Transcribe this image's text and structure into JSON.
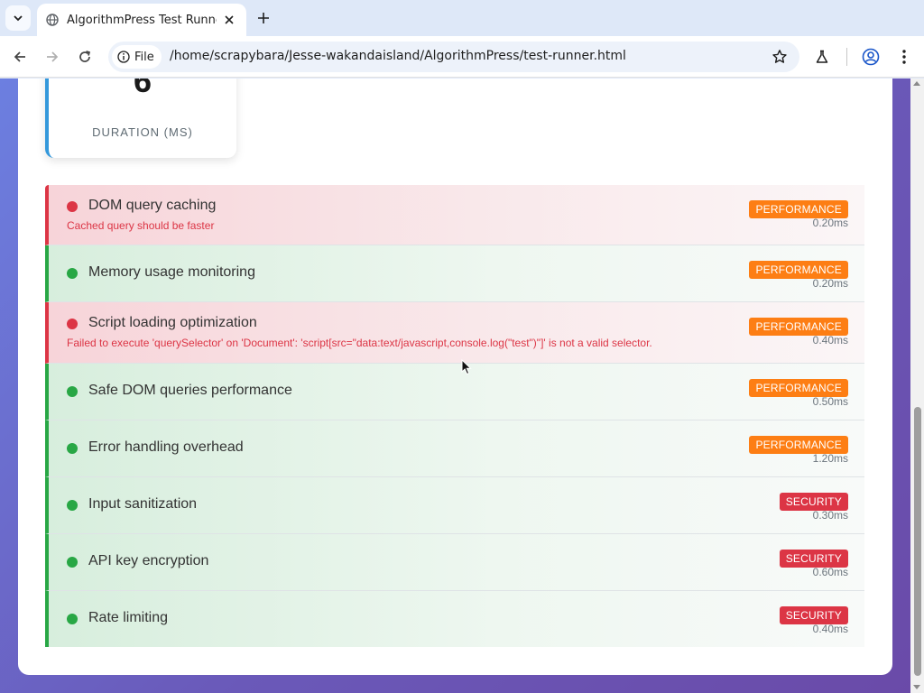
{
  "browser": {
    "tab_title": "AlgorithmPress Test Runner",
    "file_chip_label": "File",
    "url": "/home/scrapybara/Jesse-wakandaisland/AlgorithmPress/test-runner.html"
  },
  "summary": {
    "duration_value": "6",
    "duration_label": "DURATION (MS)"
  },
  "tests": [
    {
      "status": "fail",
      "name": "DOM query caching",
      "error": "Cached query should be faster",
      "category": "PERFORMANCE",
      "time": "0.20ms"
    },
    {
      "status": "pass",
      "name": "Memory usage monitoring",
      "category": "PERFORMANCE",
      "time": "0.20ms"
    },
    {
      "status": "fail",
      "name": "Script loading optimization",
      "error": "Failed to execute 'querySelector' on 'Document': 'script[src=\"data:text/javascript,console.log(\"test\")\"]' is not a valid selector.",
      "category": "PERFORMANCE",
      "time": "0.40ms"
    },
    {
      "status": "pass",
      "name": "Safe DOM queries performance",
      "category": "PERFORMANCE",
      "time": "0.50ms"
    },
    {
      "status": "pass",
      "name": "Error handling overhead",
      "category": "PERFORMANCE",
      "time": "1.20ms"
    },
    {
      "status": "pass",
      "name": "Input sanitization",
      "category": "SECURITY",
      "time": "0.30ms"
    },
    {
      "status": "pass",
      "name": "API key encryption",
      "category": "SECURITY",
      "time": "0.60ms"
    },
    {
      "status": "pass",
      "name": "Rate limiting",
      "category": "SECURITY",
      "time": "0.40ms"
    }
  ],
  "colors": {
    "pass": "#28a745",
    "fail": "#dc3545",
    "performance_badge": "#fd7e14",
    "security_badge": "#dc3545",
    "duration_accent": "#3498db"
  }
}
